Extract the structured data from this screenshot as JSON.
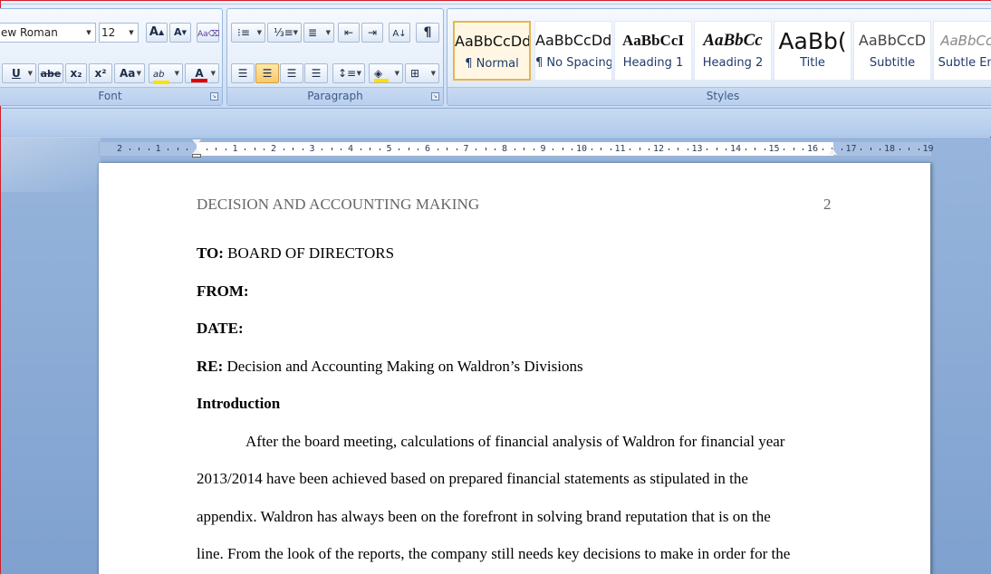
{
  "font_group": {
    "font_name": "ew Roman",
    "font_size": "12",
    "label": "Font",
    "grow_font": "A",
    "shrink_font": "A",
    "underline": "U",
    "strikethrough": "abe",
    "subscript": "x₂",
    "superscript": "x²",
    "change_case": "Aa",
    "highlight": "ab",
    "font_color": "A",
    "highlight_color": "#ffe000",
    "font_color_value": "#e00000"
  },
  "paragraph_group": {
    "label": "Paragraph"
  },
  "styles_group": {
    "label": "Styles",
    "tiles": [
      {
        "sample": "AaBbCcDd",
        "name": "¶ Normal"
      },
      {
        "sample": "AaBbCcDd",
        "name": "¶ No Spacing"
      },
      {
        "sample": "AaBbCcI",
        "name": "Heading 1"
      },
      {
        "sample": "AaBbCc",
        "name": "Heading 2"
      },
      {
        "sample": "AaBb(",
        "name": "Title"
      },
      {
        "sample": "AaBbCcD",
        "name": "Subtitle"
      },
      {
        "sample": "AaBbCcD",
        "name": "Subtle Emp"
      }
    ]
  },
  "ruler": {
    "labels": [
      "2",
      "1",
      "1",
      "2",
      "3",
      "4",
      "5",
      "6",
      "7",
      "8",
      "9",
      "10",
      "11",
      "12",
      "13",
      "14",
      "15",
      "16",
      "17",
      "18",
      "19"
    ]
  },
  "document": {
    "running_head": "DECISION AND ACCOUNTING MAKING",
    "page_number": "2",
    "to_label": "TO:",
    "to_value": "BOARD OF DIRECTORS",
    "from_label": "FROM:",
    "date_label": "DATE:",
    "re_label": "RE:",
    "re_value": "Decision and Accounting Making on Waldron’s Divisions",
    "heading": "Introduction",
    "body_lines": [
      "After the board meeting, calculations of financial analysis of Waldron for financial year",
      "2013/2014 have been achieved based on prepared financial statements as stipulated in the",
      "appendix.  Waldron has always been on the forefront in solving brand reputation that is on the",
      "line. From the look of the reports, the company still needs key decisions to make in order for the"
    ]
  }
}
